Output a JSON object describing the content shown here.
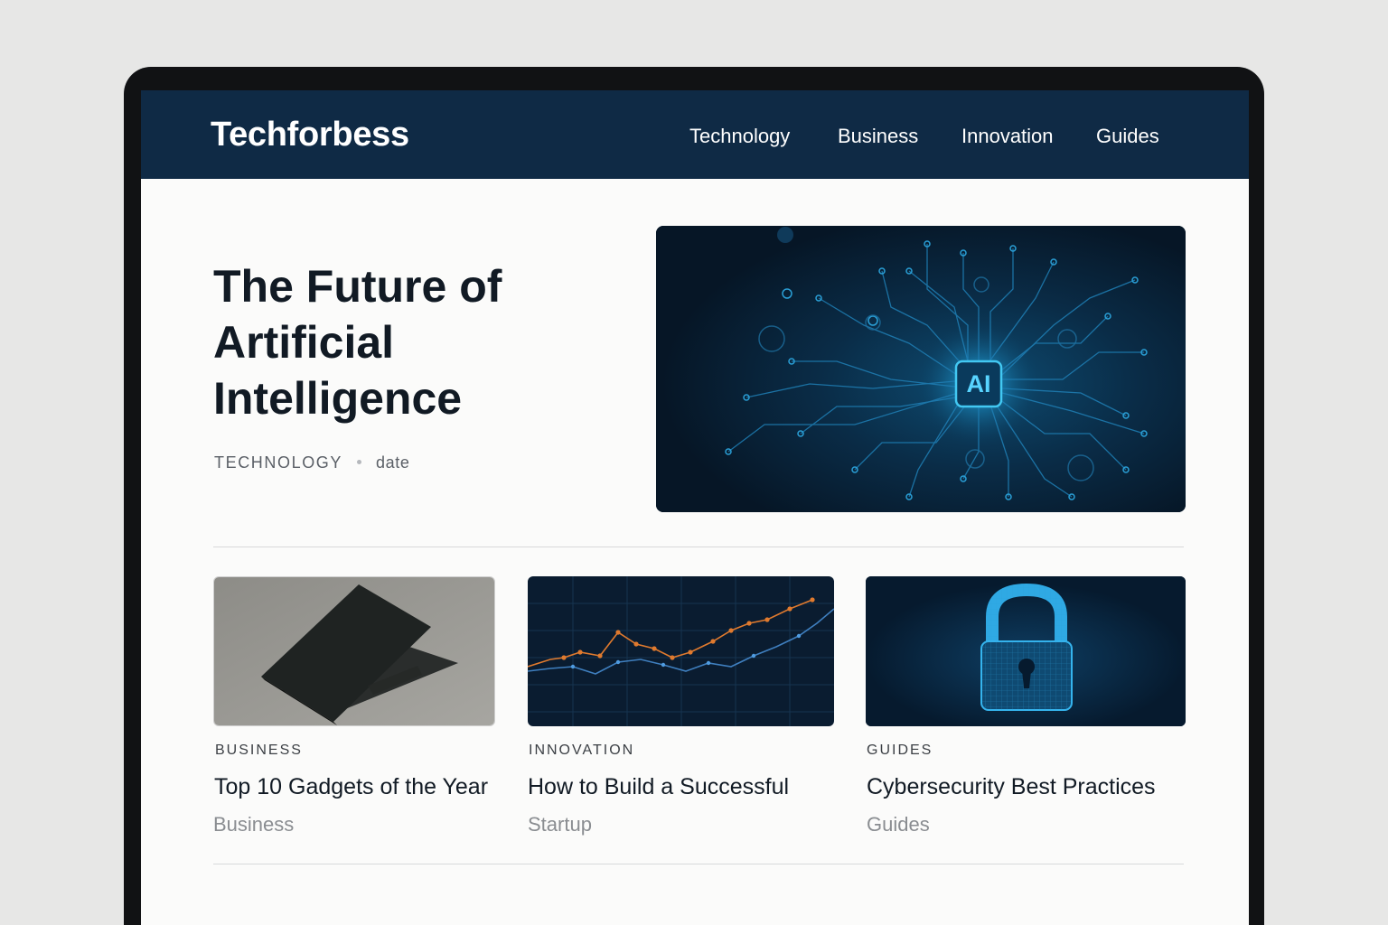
{
  "site": {
    "logo": "Techforbess"
  },
  "nav": {
    "items": [
      {
        "label": "Technology"
      },
      {
        "label": "Business"
      },
      {
        "label": "Innovation"
      },
      {
        "label": "Guides"
      }
    ]
  },
  "hero": {
    "title_lines": [
      "The Future of",
      "Artificial",
      "Intelligence"
    ],
    "category": "TECHNOLOGY",
    "date": "date",
    "image_badge": "AI"
  },
  "cards": [
    {
      "category": "BUSINESS",
      "title": "Top 10 Gadgets of the Year",
      "subtitle": "Business"
    },
    {
      "category": "INNOVATION",
      "title": "How to Build a Successful",
      "subtitle": "Startup"
    },
    {
      "category": "GUIDES",
      "title": "Cybersecurity Best Practices",
      "subtitle": "Guides"
    }
  ],
  "colors": {
    "navbar": "#0f2a45",
    "accent_cyan": "#2fb8e8",
    "chart_orange": "#e07a2e"
  },
  "icons": {
    "hero_image": "ai-circuit-chip-icon",
    "card_1": "laptop-icon",
    "card_2": "growth-chart-icon",
    "card_3": "padlock-icon"
  }
}
